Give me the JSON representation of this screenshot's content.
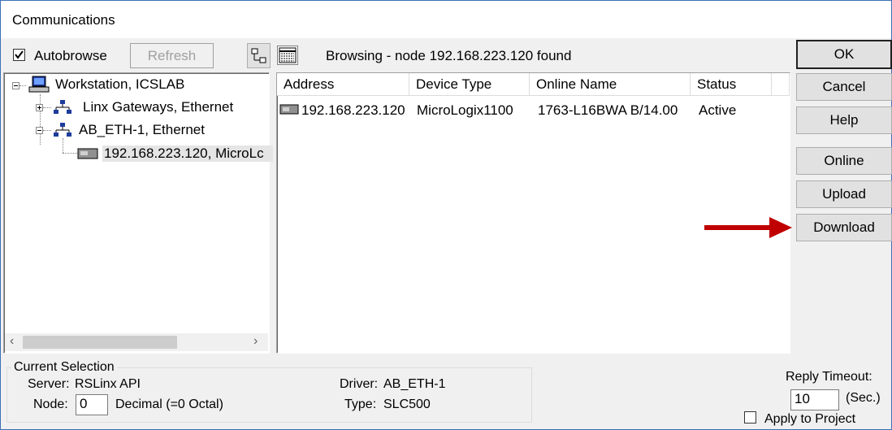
{
  "window": {
    "title": "Communications"
  },
  "toolbar": {
    "autobrowse_label": "Autobrowse",
    "autobrowse_checked": true,
    "refresh_label": "Refresh",
    "status_text": "Browsing - node 192.168.223.120 found"
  },
  "tree": {
    "root": "Workstation, ICSLAB",
    "children": [
      {
        "label": "Linx Gateways, Ethernet",
        "expanded": false
      },
      {
        "label": "AB_ETH-1, Ethernet",
        "expanded": true,
        "children": [
          {
            "label": "192.168.223.120, MicroLc"
          }
        ]
      }
    ]
  },
  "table": {
    "columns": [
      "Address",
      "Device Type",
      "Online Name",
      "Status"
    ],
    "rows": [
      [
        "192.168.223.120",
        "MicroLogix1100",
        "1763-L16BWA B/14.00",
        "Active"
      ]
    ]
  },
  "buttons": {
    "ok": "OK",
    "cancel": "Cancel",
    "help": "Help",
    "online": "Online",
    "upload": "Upload",
    "download": "Download"
  },
  "current_selection": {
    "title": "Current Selection",
    "server_label": "Server:",
    "server_value": "RSLinx API",
    "node_label": "Node:",
    "node_value": "0",
    "node_format": "Decimal (=0 Octal)",
    "driver_label": "Driver:",
    "driver_value": "AB_ETH-1",
    "type_label": "Type:",
    "type_value": "SLC500"
  },
  "reply": {
    "label": "Reply Timeout:",
    "value": "10",
    "unit": "(Sec.)",
    "apply_label": "Apply to Project",
    "apply_checked": false
  },
  "colors": {
    "arrow": "#c00000",
    "border": "#3c6fb6"
  }
}
